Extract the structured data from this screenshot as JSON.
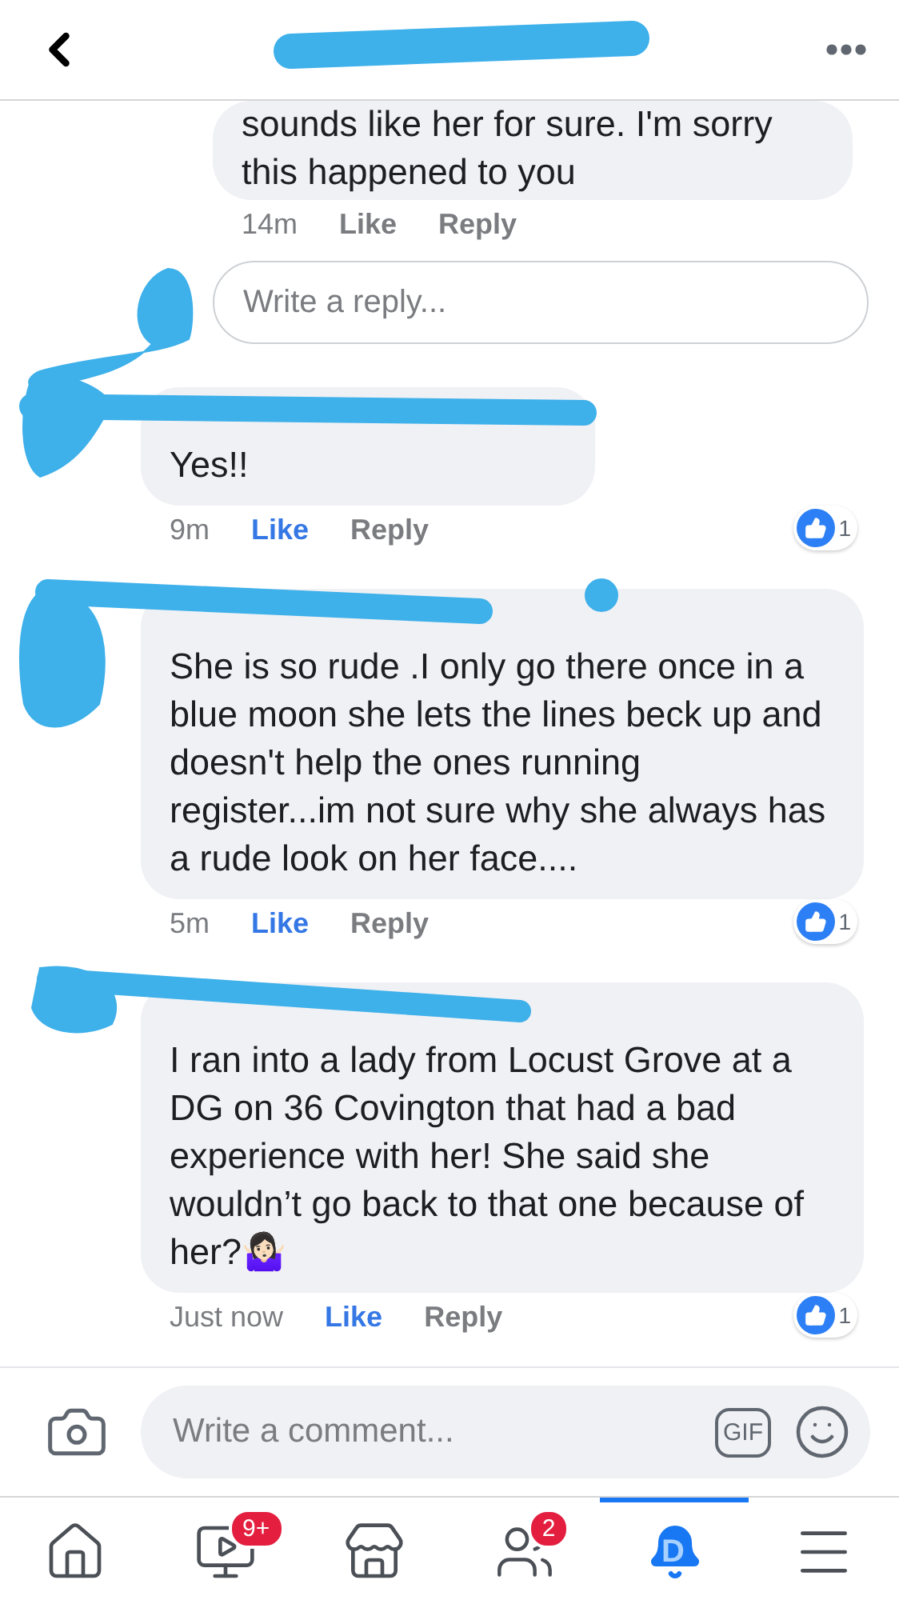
{
  "comments": [
    {
      "kind": "reply",
      "text": "sounds like her for sure. I'm sorry this happened to you",
      "time": "14m",
      "like": "Like",
      "liked": false,
      "reply": "Reply"
    },
    {
      "kind": "comment",
      "text": "Yes!!",
      "time": "9m",
      "like": "Like",
      "liked": true,
      "reply": "Reply",
      "reactions": "1"
    },
    {
      "kind": "comment",
      "text": "She is so rude .I only go there once in a blue moon she lets the lines beck up and doesn't help the ones running register...im not sure why she always has a rude look on her face....",
      "time": "5m",
      "like": "Like",
      "liked": true,
      "reply": "Reply",
      "reactions": "1"
    },
    {
      "kind": "comment",
      "text": "I ran into a lady from Locust Grove at a DG on 36 Covington that had a bad experience with her! She said she wouldn’t go back to that one because of her?🤷🏻‍♀️",
      "time": "Just now",
      "like": "Like",
      "liked": true,
      "reply": "Reply",
      "reactions": "1"
    }
  ],
  "reply_field": {
    "placeholder": "Write a reply..."
  },
  "composer": {
    "placeholder": "Write a comment...",
    "gif": "GIF"
  },
  "nav": [
    {
      "kind": "home",
      "selected": false
    },
    {
      "kind": "video",
      "selected": false,
      "badge": "9+"
    },
    {
      "kind": "market",
      "selected": false
    },
    {
      "kind": "groups",
      "selected": false,
      "badge": "2"
    },
    {
      "kind": "bell",
      "selected": true,
      "letter": "D"
    },
    {
      "kind": "menu",
      "selected": false
    }
  ]
}
